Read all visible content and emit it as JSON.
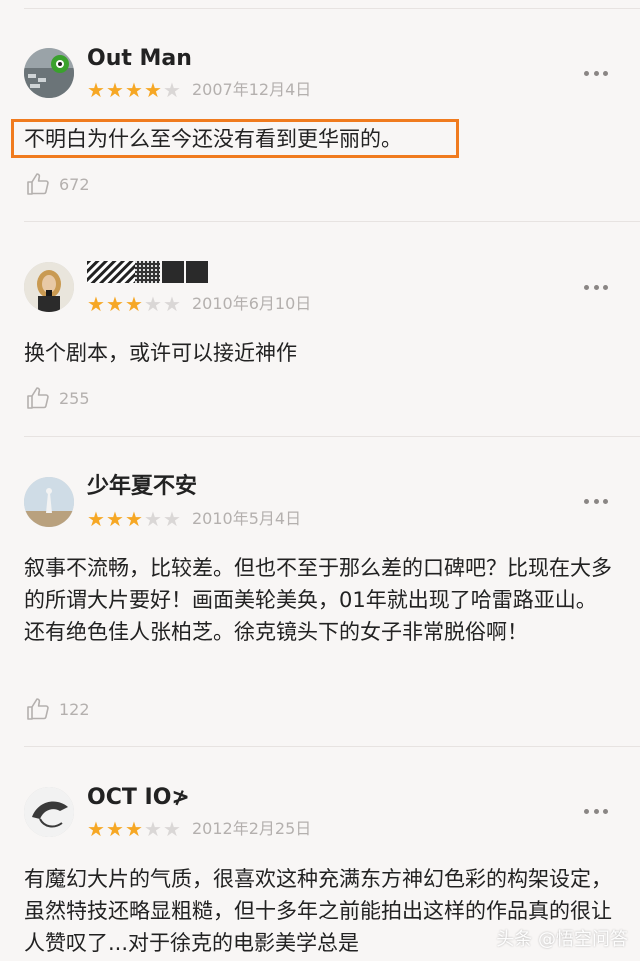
{
  "reviews": [
    {
      "username": "Out Man",
      "rating": 4,
      "date": "2007年12月4日",
      "text": "不明白为什么至今还没有看到更华丽的。",
      "likes": "672",
      "highlighted": true
    },
    {
      "username": "",
      "rating": 3,
      "date": "2010年6月10日",
      "text": "换个剧本，或许可以接近神作",
      "likes": "255",
      "highlighted": false
    },
    {
      "username": "少年夏不安",
      "rating": 3,
      "date": "2010年5月4日",
      "text": "叙事不流畅，比较差。但也不至于那么差的口碑吧？比现在大多的所谓大片要好！画面美轮美奂，01年就出现了哈雷路亚山。还有绝色佳人张柏芝。徐克镜头下的女子非常脱俗啊！",
      "likes": "122",
      "highlighted": false
    },
    {
      "username": "OCT IO≯",
      "rating": 3,
      "date": "2012年2月25日",
      "text": "有魔幻大片的气质，很喜欢这种充满东方神幻色彩的构架设定，虽然特技还略显粗糙，但十多年之前能拍出这样的作品真的很让人赞叹了...对于徐克的电影美学总是",
      "likes": "",
      "highlighted": false
    }
  ],
  "watermark": "头条 @悟空问答",
  "colors": {
    "star_on": "#f6a724",
    "star_off": "#dad7d6",
    "highlight_border": "#f07b1e",
    "background": "#f8f6f5"
  },
  "icons": [
    "more-options-icon",
    "thumbs-up-icon"
  ]
}
